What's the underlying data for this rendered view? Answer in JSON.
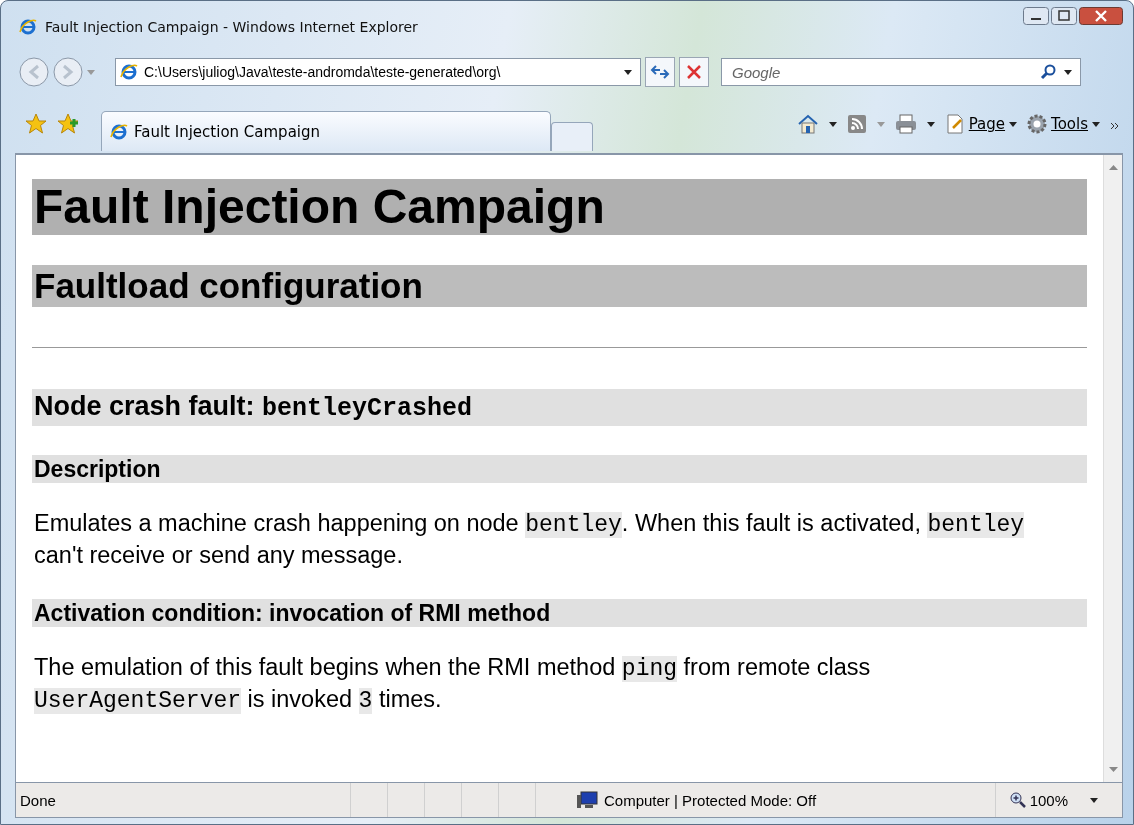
{
  "window": {
    "title": "Fault Injection Campaign - Windows Internet Explorer"
  },
  "address_bar": {
    "value": "C:\\Users\\juliog\\Java\\teste-andromda\\teste-generated\\org\\"
  },
  "search": {
    "placeholder": "Google"
  },
  "tabs": [
    {
      "label": "Fault Injection Campaign",
      "selected": true
    }
  ],
  "commands": [
    {
      "label": "Page",
      "kind": "menu"
    },
    {
      "label": "Tools",
      "kind": "menu"
    }
  ],
  "page": {
    "title": "Fault Injection Campaign",
    "subtitle": "Faultload configuration",
    "blocks": [
      {
        "kind": "h3",
        "parts": [
          {
            "text": "Node crash fault: ",
            "code": false
          },
          {
            "text": "bentleyCrashed",
            "code": true
          }
        ]
      },
      {
        "kind": "h4",
        "parts": [
          {
            "text": "Description",
            "code": false
          }
        ]
      },
      {
        "kind": "p",
        "parts": [
          {
            "text": "Emulates a machine crash happening on node ",
            "code": false
          },
          {
            "text": "bentley",
            "code": true
          },
          {
            "text": ". When this fault is activated, ",
            "code": false
          },
          {
            "text": "bentley",
            "code": true
          },
          {
            "text": " can't receive or send any message.",
            "code": false
          }
        ]
      },
      {
        "kind": "h4",
        "parts": [
          {
            "text": "Activation condition: invocation of RMI method",
            "code": false
          }
        ]
      },
      {
        "kind": "p",
        "parts": [
          {
            "text": "The emulation of this fault begins when the RMI method ",
            "code": false
          },
          {
            "text": "ping",
            "code": true
          },
          {
            "text": " from remote class ",
            "code": false
          },
          {
            "text": "UserAgentServer",
            "code": true
          },
          {
            "text": " is invoked ",
            "code": false
          },
          {
            "text": "3",
            "code": true
          },
          {
            "text": " times.",
            "code": false
          }
        ]
      }
    ]
  },
  "status_bar": {
    "text": "Done",
    "zone": "Computer | Protected Mode: Off",
    "zoom": "100%"
  }
}
